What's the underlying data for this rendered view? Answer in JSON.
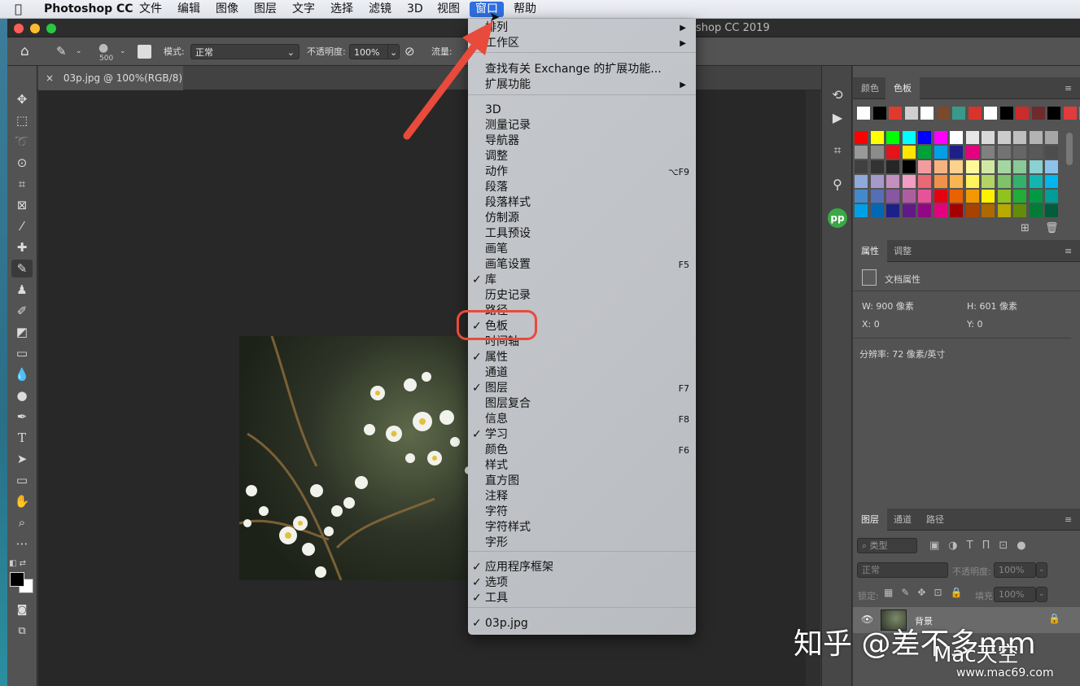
{
  "menubar": {
    "apple": "",
    "app": "Photoshop CC",
    "items": [
      "文件",
      "编辑",
      "图像",
      "图层",
      "文字",
      "选择",
      "滤镜",
      "3D",
      "视图",
      "窗口",
      "帮助"
    ]
  },
  "window": {
    "title": "Adobe Photoshop CC 2019",
    "title_visible": "shop CC 2019"
  },
  "options": {
    "brush_size": "500",
    "mode_label": "模式:",
    "mode_value": "正常",
    "opacity_label": "不透明度:",
    "opacity_value": "100%",
    "flow_label": "流量:"
  },
  "document_tab": {
    "close": "×",
    "title": "03p.jpg @ 100%(RGB/8)"
  },
  "panels": {
    "swatch_tabs": [
      "颜色",
      "色板"
    ],
    "props_tabs": [
      "属性",
      "调整"
    ],
    "doc_props": "文档属性",
    "w": "W:  900 像素",
    "h": "H:  601 像素",
    "x": "X:  0",
    "y": "Y:  0",
    "resolution": "分辨率: 72 像素/英寸",
    "layer_tabs": [
      "图层",
      "通道",
      "路径"
    ],
    "layer_filter": "类型",
    "blend_mode": "正常",
    "layer_opacity_label": "不透明度:",
    "layer_opacity": "100%",
    "lock_label": "锁定:",
    "fill_label": "填充:",
    "fill_value": "100%",
    "layer_name": "背景"
  },
  "menu": {
    "items": [
      {
        "label": "排列",
        "submenu": true
      },
      {
        "label": "工作区",
        "submenu": true
      },
      {
        "label": "查找有关 Exchange 的扩展功能..."
      },
      {
        "label": "扩展功能",
        "submenu": true
      },
      {
        "label": "3D"
      },
      {
        "label": "测量记录"
      },
      {
        "label": "导航器"
      },
      {
        "label": "调整"
      },
      {
        "label": "动作",
        "shortcut": "⌥F9"
      },
      {
        "label": "段落"
      },
      {
        "label": "段落样式"
      },
      {
        "label": "仿制源"
      },
      {
        "label": "工具预设"
      },
      {
        "label": "画笔"
      },
      {
        "label": "画笔设置",
        "shortcut": "F5"
      },
      {
        "label": "库",
        "checked": true
      },
      {
        "label": "历史记录"
      },
      {
        "label": "路径"
      },
      {
        "label": "色板",
        "checked": true
      },
      {
        "label": "时间轴"
      },
      {
        "label": "属性",
        "checked": true
      },
      {
        "label": "通道"
      },
      {
        "label": "图层",
        "checked": true,
        "shortcut": "F7"
      },
      {
        "label": "图层复合"
      },
      {
        "label": "信息",
        "shortcut": "F8"
      },
      {
        "label": "学习",
        "checked": true
      },
      {
        "label": "颜色",
        "shortcut": "F6"
      },
      {
        "label": "样式"
      },
      {
        "label": "直方图"
      },
      {
        "label": "注释"
      },
      {
        "label": "字符"
      },
      {
        "label": "字符样式"
      },
      {
        "label": "字形"
      },
      {
        "label": "应用程序框架",
        "checked": true
      },
      {
        "label": "选项",
        "checked": true
      },
      {
        "label": "工具",
        "checked": true
      },
      {
        "label": "03p.jpg",
        "checked": true
      }
    ],
    "checkmark": "✓",
    "arrow": "▶"
  },
  "watermark": {
    "zhihu": "知乎 @差不多mm",
    "site_logo": "Mac天空",
    "site_url": "www.mac69.com"
  },
  "colors": {
    "menu_highlight": "#2f6fe0",
    "annotation": "#e84a3c"
  },
  "swatches_top": [
    "#ffffff",
    "#000000",
    "#e03a2e",
    "#cfcfcf",
    "#ffffff",
    "#7a4a2a",
    "#3a9a8a",
    "#d9342b",
    "#ffffff",
    "#000000",
    "#cc2b2b",
    "#6d2b2b",
    "#000000",
    "#e23b3b",
    "#6ba24a",
    "#8a3a5a",
    "#b04a6a"
  ],
  "swatch_grid": [
    [
      "#ff0000",
      "#ffff00",
      "#00ff00",
      "#00ffff",
      "#0000ff",
      "#ff00ff",
      "#ffffff",
      "#e6e6e6",
      "#d9d9d9",
      "#cccccc",
      "#bfbfbf",
      "#b3b3b3",
      "#a6a6a6"
    ],
    [
      "#999999",
      "#8c8c8c",
      "#e5131a",
      "#ffe600",
      "#00a13a",
      "#00a0e9",
      "#1d2088",
      "#e4007f",
      "#808080",
      "#737373",
      "#666666",
      "#595959",
      "#4d4d4d"
    ],
    [
      "#404040",
      "#333333",
      "#262626",
      "#000000",
      "#f29c9f",
      "#f6b37f",
      "#fcd28c",
      "#fff899",
      "#d1e8a4",
      "#a3d6a0",
      "#89c997",
      "#8ad1cf",
      "#8bc3ea"
    ],
    [
      "#8fa9da",
      "#a59aca",
      "#c490bf",
      "#f19ec2",
      "#eb6877",
      "#f19149",
      "#f8b551",
      "#fff45c",
      "#b3d465",
      "#80c269",
      "#32b16c",
      "#13b5b1",
      "#00b7ee"
    ],
    [
      "#448aca",
      "#556fb5",
      "#8957a1",
      "#ae5da1",
      "#e85298",
      "#e60012",
      "#eb6100",
      "#f39800",
      "#fff100",
      "#8fc31f",
      "#22ac38",
      "#009944",
      "#009e96"
    ],
    [
      "#00a0e9",
      "#0068b7",
      "#1d2088",
      "#601986",
      "#920783",
      "#e4007f",
      "#a40000",
      "#a84200",
      "#ac6a00",
      "#b7aa00",
      "#638c0b",
      "#007c36",
      "#005e3c"
    ]
  ]
}
